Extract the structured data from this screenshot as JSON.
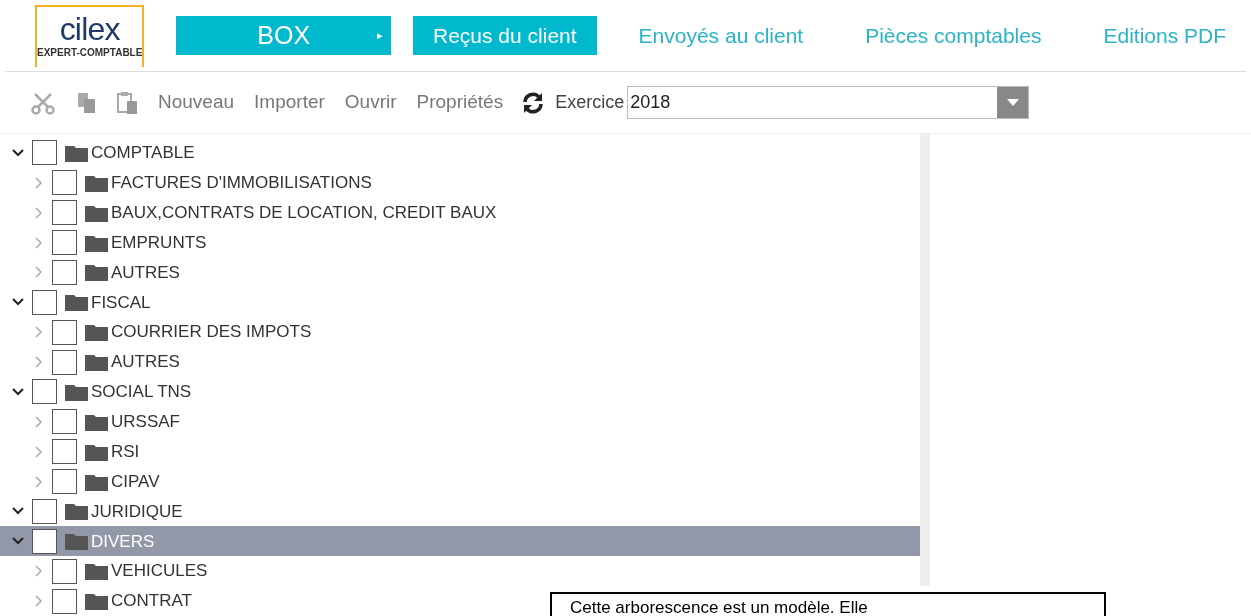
{
  "logo": {
    "name": "cilex",
    "tagline": "EXPERT-COMPTABLE"
  },
  "box_menu": {
    "label": "BOX",
    "arrow": "▸"
  },
  "tabs": [
    {
      "label": "Reçus du client",
      "selected": true
    },
    {
      "label": "Envoyés au client",
      "selected": false
    },
    {
      "label": "Pièces comptables",
      "selected": false
    },
    {
      "label": "Editions PDF",
      "selected": false
    }
  ],
  "toolbar": {
    "actions": [
      {
        "label": "Nouveau"
      },
      {
        "label": "Importer"
      },
      {
        "label": "Ouvrir"
      },
      {
        "label": "Propriétés"
      }
    ],
    "exercice_label": "Exercice",
    "exercice_value": "2018"
  },
  "tree": [
    {
      "label": "COMPTABLE",
      "expanded": true,
      "checked": false,
      "selected": false,
      "children": [
        {
          "label": "FACTURES D'IMMOBILISATIONS",
          "expanded": false,
          "checked": false,
          "selected": false
        },
        {
          "label": "BAUX,CONTRATS DE LOCATION, CREDIT BAUX",
          "expanded": false,
          "checked": false,
          "selected": false
        },
        {
          "label": "EMPRUNTS",
          "expanded": false,
          "checked": false,
          "selected": false
        },
        {
          "label": "AUTRES",
          "expanded": false,
          "checked": false,
          "selected": false
        }
      ]
    },
    {
      "label": "FISCAL",
      "expanded": true,
      "checked": false,
      "selected": false,
      "children": [
        {
          "label": "COURRIER DES IMPOTS",
          "expanded": false,
          "checked": false,
          "selected": false
        },
        {
          "label": "AUTRES",
          "expanded": false,
          "checked": false,
          "selected": false
        }
      ]
    },
    {
      "label": "SOCIAL TNS",
      "expanded": true,
      "checked": false,
      "selected": false,
      "children": [
        {
          "label": "URSSAF",
          "expanded": false,
          "checked": false,
          "selected": false
        },
        {
          "label": "RSI",
          "expanded": false,
          "checked": false,
          "selected": false
        },
        {
          "label": "CIPAV",
          "expanded": false,
          "checked": false,
          "selected": false
        }
      ]
    },
    {
      "label": "JURIDIQUE",
      "expanded": true,
      "checked": false,
      "selected": false
    },
    {
      "label": "DIVERS",
      "expanded": true,
      "checked": false,
      "selected": true,
      "children": [
        {
          "label": "VEHICULES",
          "expanded": false,
          "checked": false,
          "selected": false
        },
        {
          "label": "CONTRAT",
          "expanded": false,
          "checked": false,
          "selected": false
        }
      ]
    }
  ],
  "callout": {
    "text": "Cette arborescence est un modèle. Elle"
  }
}
